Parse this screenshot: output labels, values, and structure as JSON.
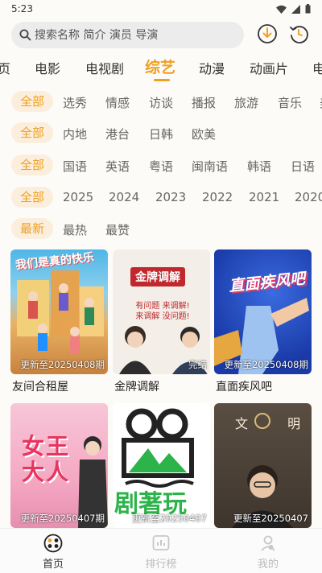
{
  "status": {
    "time": "5:23"
  },
  "search": {
    "placeholder": "搜索名称 简介 演员 导演"
  },
  "category_tabs": [
    {
      "label": "页"
    },
    {
      "label": "电影"
    },
    {
      "label": "电视剧"
    },
    {
      "label": "综艺"
    },
    {
      "label": "动漫"
    },
    {
      "label": "动画片"
    },
    {
      "label": "电"
    }
  ],
  "active_category": "综艺",
  "filters": {
    "type": [
      "全部",
      "选秀",
      "情感",
      "访谈",
      "播报",
      "旅游",
      "音乐",
      "美"
    ],
    "region": [
      "全部",
      "内地",
      "港台",
      "日韩",
      "欧美"
    ],
    "language": [
      "全部",
      "国语",
      "英语",
      "粤语",
      "闽南语",
      "韩语",
      "日语"
    ],
    "year": [
      "全部",
      "2025",
      "2024",
      "2023",
      "2022",
      "2021",
      "2020"
    ],
    "sort": [
      "最新",
      "最热",
      "最赞"
    ]
  },
  "cards": [
    {
      "title": "友间合租屋",
      "note": "更新至20250408期",
      "poster_text": "我们是真的快乐"
    },
    {
      "title": "金牌调解",
      "note": "完结",
      "poster_text": "金牌调解",
      "poster_sub": "有问题 来调解! 来调解 没问题!"
    },
    {
      "title": "直面疾风吧",
      "note": "更新至20250408期",
      "poster_text": "直面疾风吧"
    },
    {
      "title": "",
      "note": "更新至20250407期",
      "poster_text": "女王大人"
    },
    {
      "title": "",
      "note": "更新至20250407",
      "poster_text": "剧著玩"
    },
    {
      "title": "",
      "note": "更新至20250407",
      "poster_text": "文 明"
    }
  ],
  "bottom_nav": [
    {
      "label": "首页"
    },
    {
      "label": "排行榜"
    },
    {
      "label": "我的"
    }
  ],
  "colors": {
    "accent": "#f0a020",
    "chip_bg": "#fbeedd"
  }
}
